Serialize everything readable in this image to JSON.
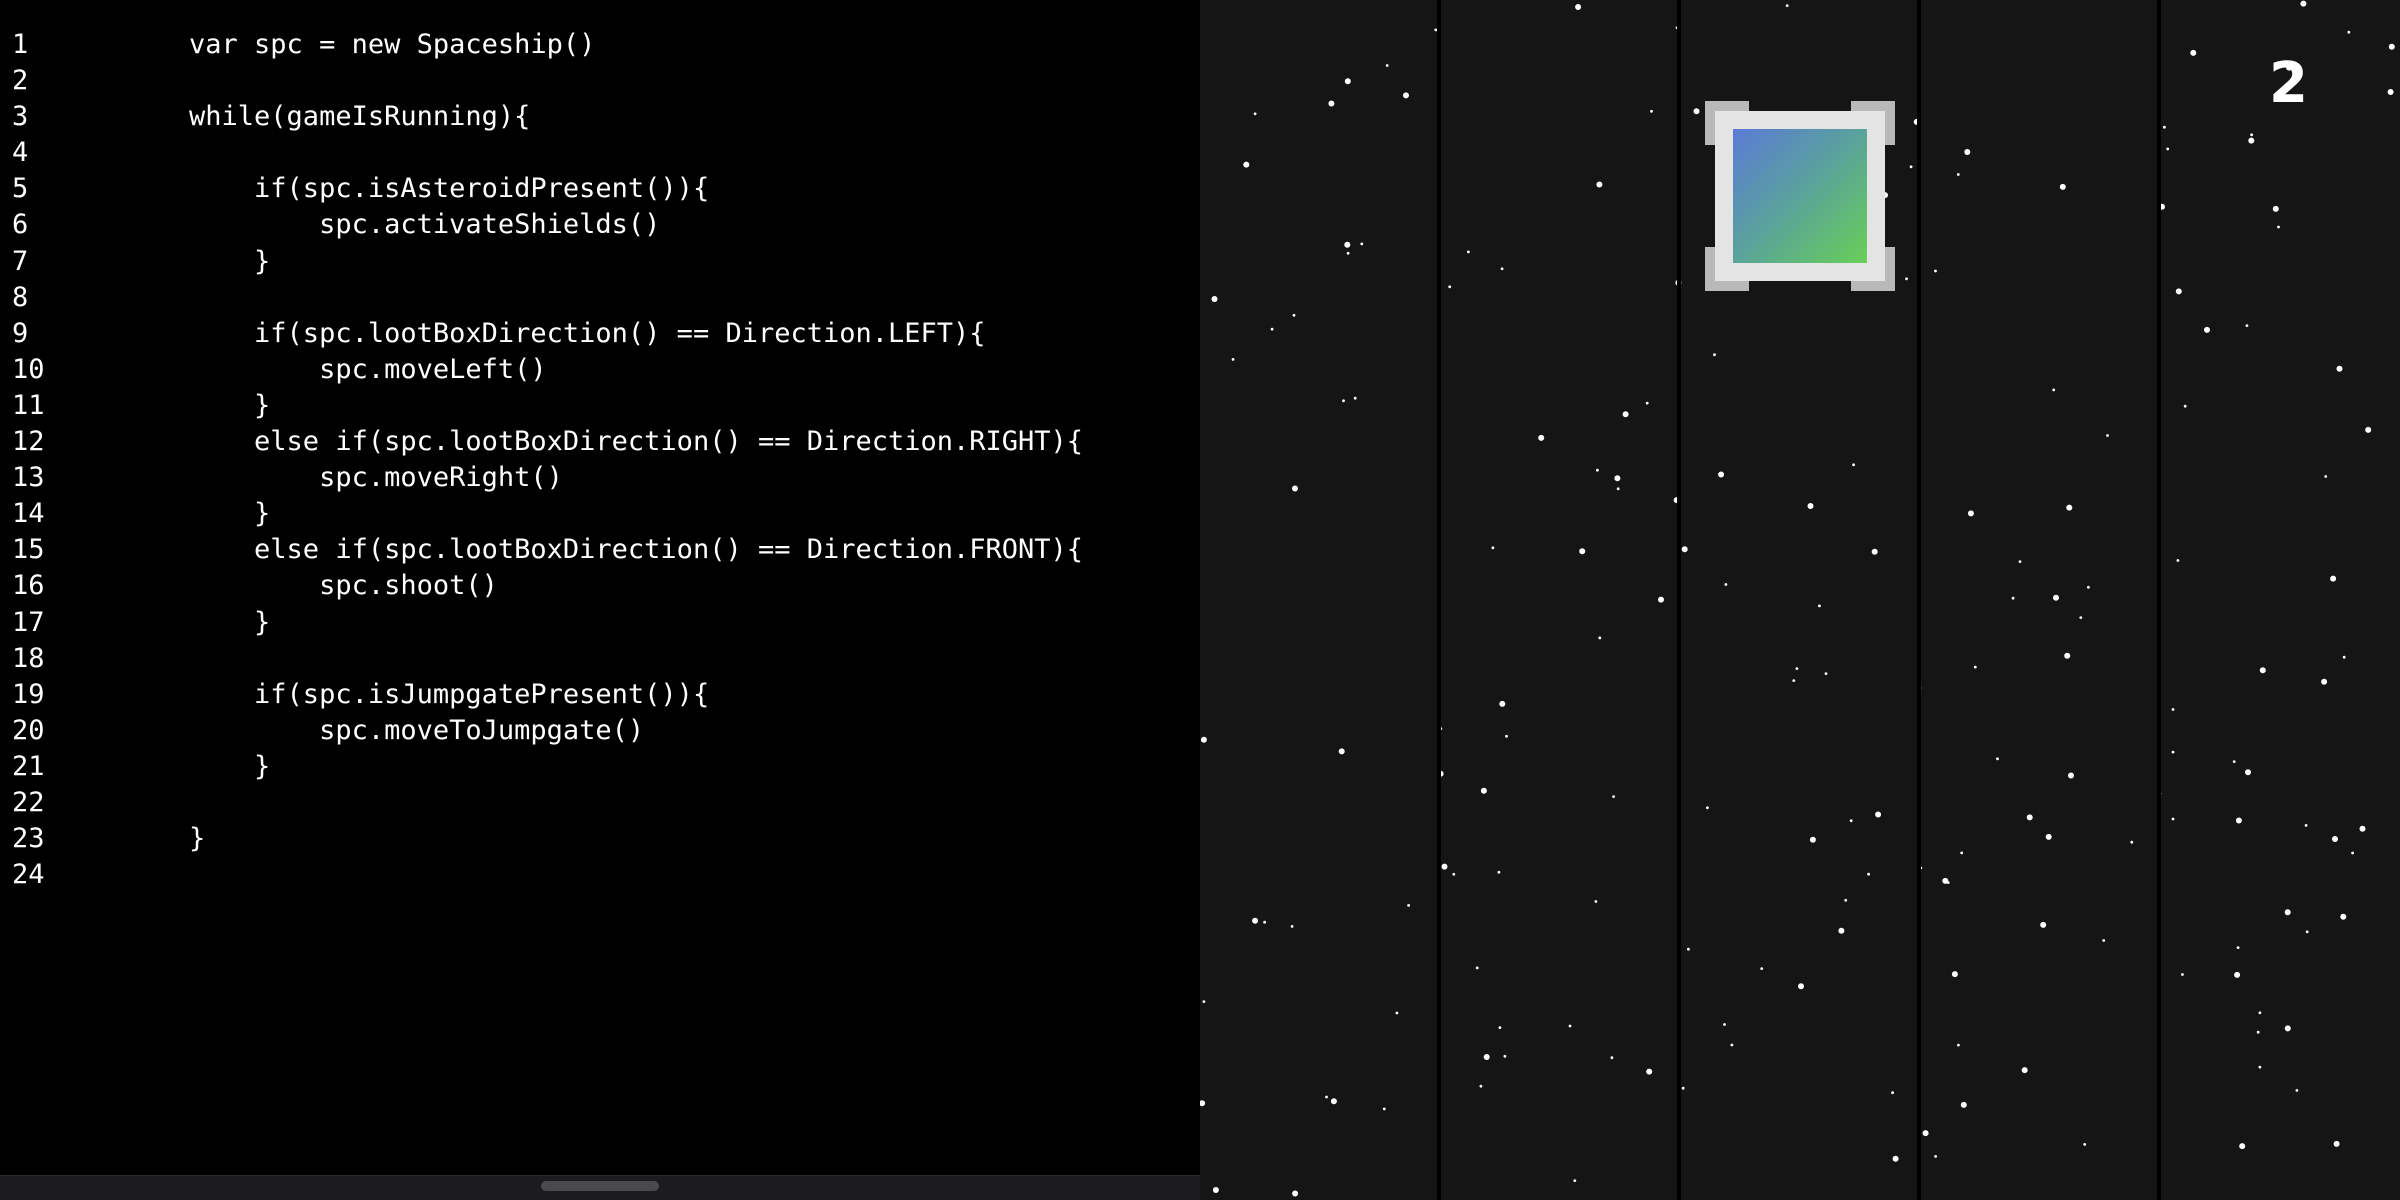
{
  "editor": {
    "lines": [
      {
        "number": "1",
        "text": "    var spc = new Spaceship()"
      },
      {
        "number": "2",
        "text": ""
      },
      {
        "number": "3",
        "text": "    while(gameIsRunning){"
      },
      {
        "number": "4",
        "text": ""
      },
      {
        "number": "5",
        "text": "        if(spc.isAsteroidPresent()){"
      },
      {
        "number": "6",
        "text": "            spc.activateShields()"
      },
      {
        "number": "7",
        "text": "        }"
      },
      {
        "number": "8",
        "text": ""
      },
      {
        "number": "9",
        "text": "        if(spc.lootBoxDirection() == Direction.LEFT){"
      },
      {
        "number": "10",
        "text": "            spc.moveLeft()"
      },
      {
        "number": "11",
        "text": "        }"
      },
      {
        "number": "12",
        "text": "        else if(spc.lootBoxDirection() == Direction.RIGHT){"
      },
      {
        "number": "13",
        "text": "            spc.moveRight()"
      },
      {
        "number": "14",
        "text": "        }"
      },
      {
        "number": "15",
        "text": "        else if(spc.lootBoxDirection() == Direction.FRONT){"
      },
      {
        "number": "16",
        "text": "            spc.shoot()"
      },
      {
        "number": "17",
        "text": "        }"
      },
      {
        "number": "18",
        "text": ""
      },
      {
        "number": "19",
        "text": "        if(spc.isJumpgatePresent()){"
      },
      {
        "number": "20",
        "text": "            spc.moveToJumpgate()"
      },
      {
        "number": "21",
        "text": "        }"
      },
      {
        "number": "22",
        "text": ""
      },
      {
        "number": "23",
        "text": "    }"
      },
      {
        "number": "24",
        "text": ""
      }
    ]
  },
  "game": {
    "score": "2",
    "lanes": 5,
    "colors": {
      "background": "#151515",
      "lane_divider": "#000000",
      "star": "#ffffff",
      "loot_box_frame": "#e4e4e4",
      "loot_box_gradient_start": "#5b7bd6",
      "loot_box_gradient_end": "#68cf58"
    },
    "loot_box": {
      "icon": "loot-box-icon"
    }
  }
}
